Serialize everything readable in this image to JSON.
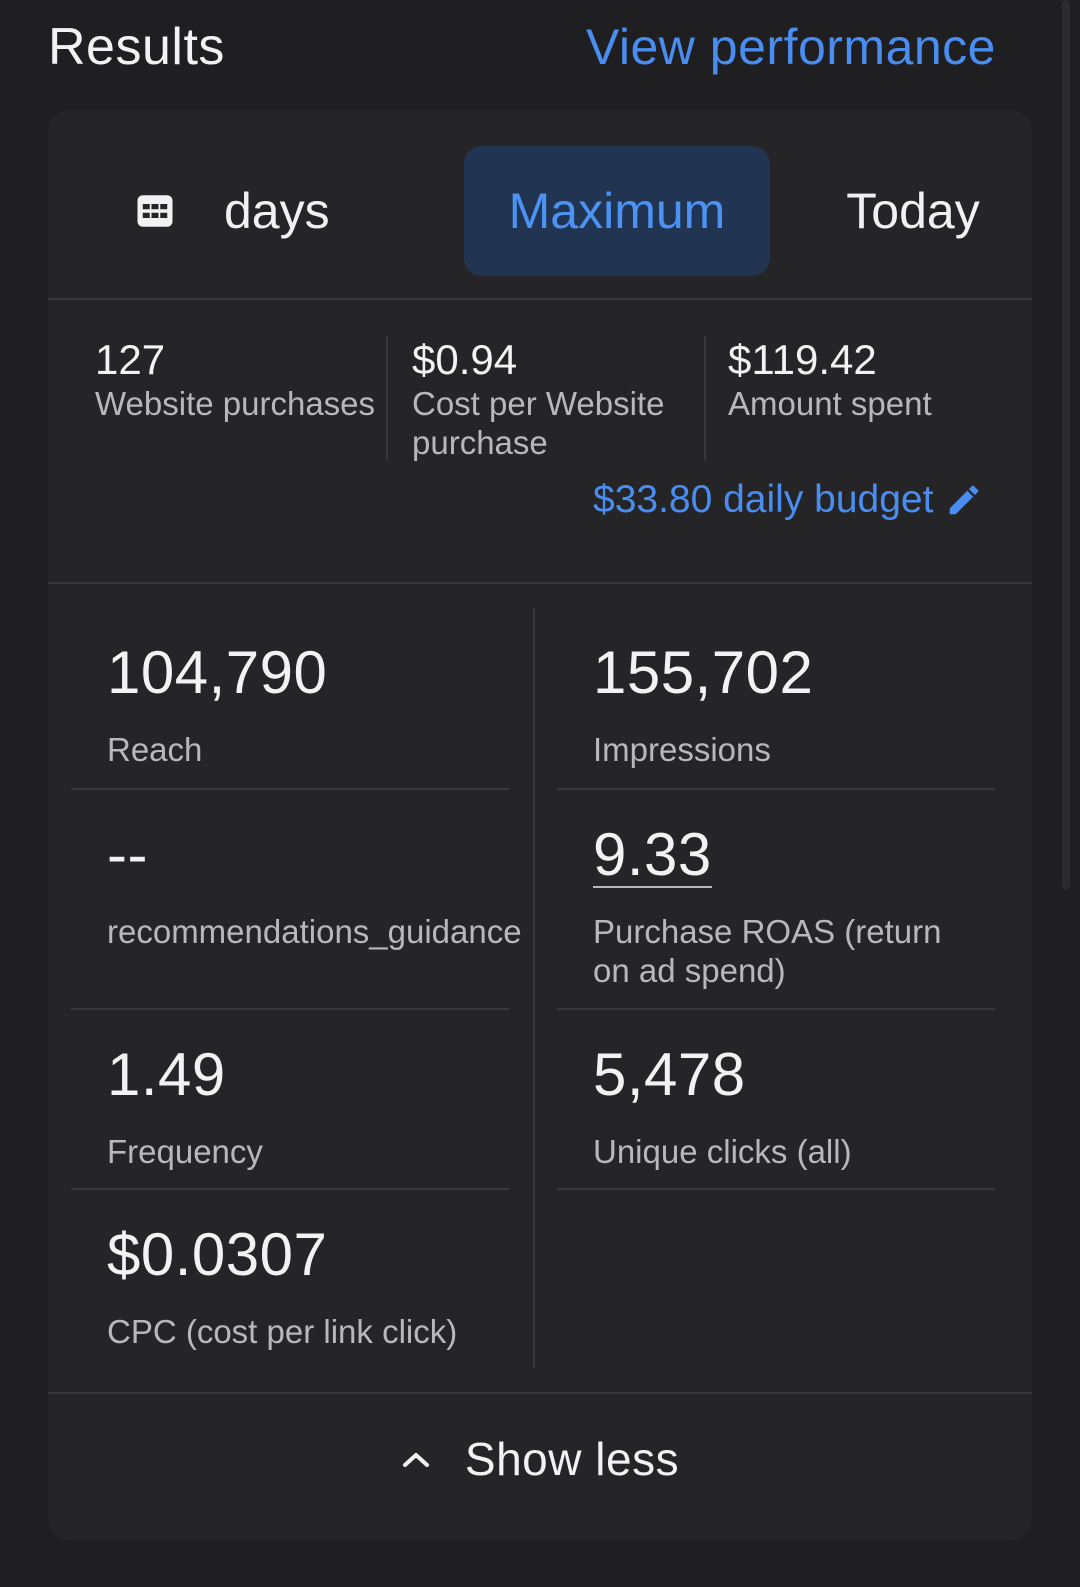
{
  "header": {
    "title": "Results",
    "view_link": "View performance"
  },
  "tabs": [
    {
      "label": "days",
      "icon": "calendar-icon"
    },
    {
      "label": "Maximum",
      "selected": true
    },
    {
      "label": "Today"
    }
  ],
  "summary": [
    {
      "value": "127",
      "label": "Website purchases"
    },
    {
      "value": "$0.94",
      "label": "Cost per Website purchase"
    },
    {
      "value": "$119.42",
      "label": "Amount spent"
    }
  ],
  "budget": {
    "text": "$33.80 daily budget",
    "icon": "pencil-icon"
  },
  "metrics": {
    "reach": {
      "value": "104,790",
      "label": "Reach"
    },
    "impressions": {
      "value": "155,702",
      "label": "Impressions"
    },
    "recommendations": {
      "value": "--",
      "label": "recommendations_guidance"
    },
    "roas": {
      "value": "9.33",
      "label": "Purchase ROAS (return on ad spend)"
    },
    "frequency": {
      "value": "1.49",
      "label": "Frequency"
    },
    "unique_clicks": {
      "value": "5,478",
      "label": "Unique clicks (all)"
    },
    "cpc": {
      "value": "$0.0307",
      "label": "CPC (cost per link click)"
    }
  },
  "footer": {
    "show_less": "Show less",
    "icon": "chevron-up-icon"
  },
  "colors": {
    "background": "#1f1f21",
    "card": "#252527",
    "accent": "#4a8df0",
    "selected_tab_bg": "#213553"
  }
}
